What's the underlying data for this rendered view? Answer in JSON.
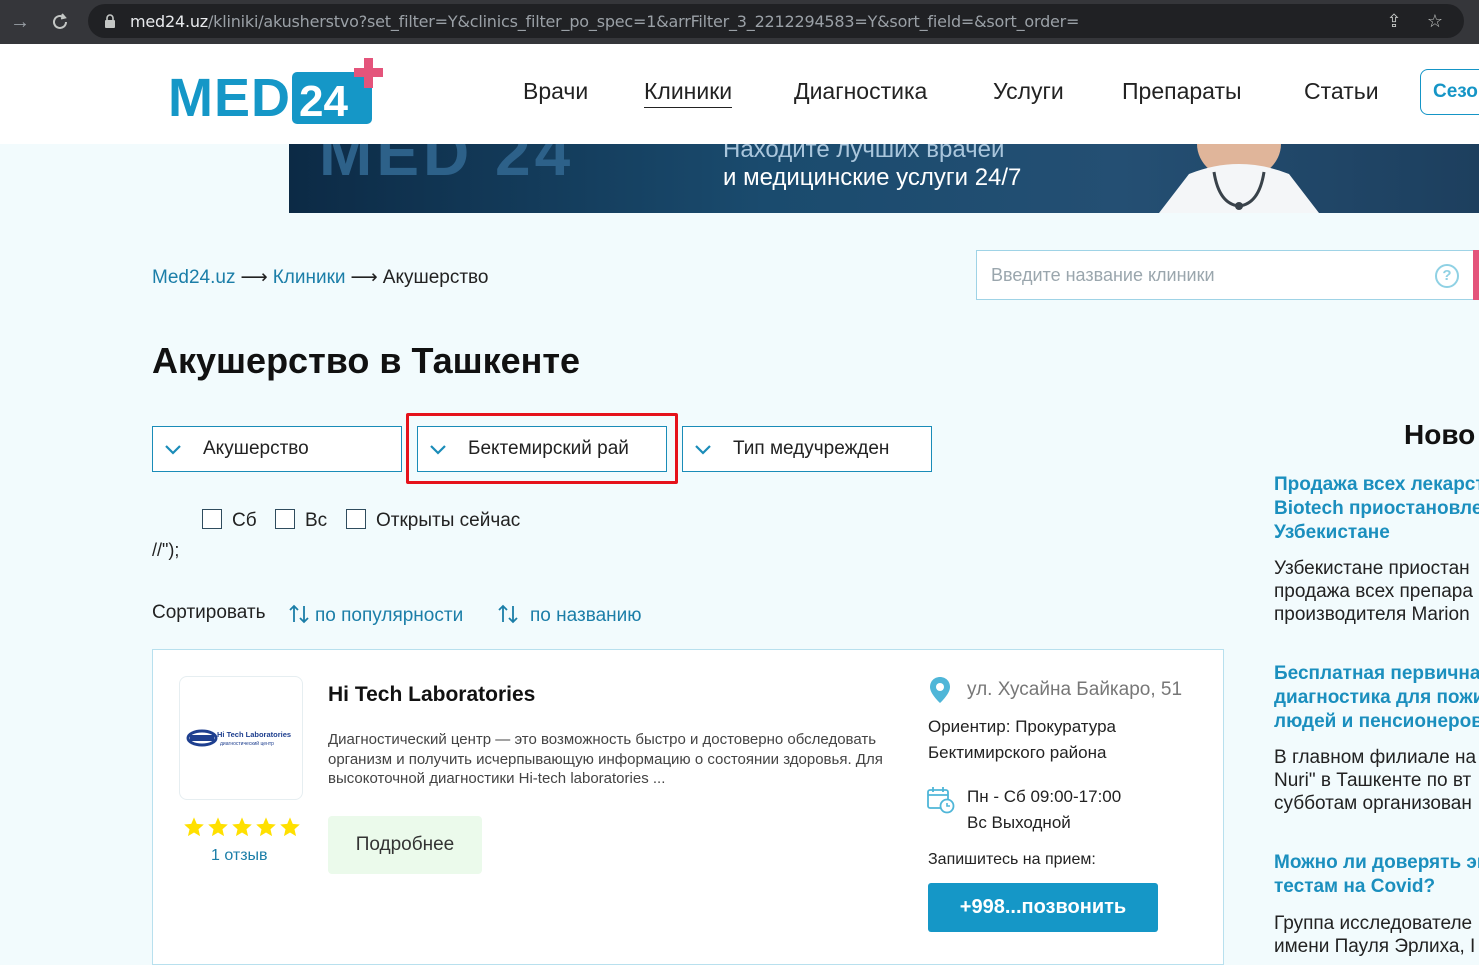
{
  "browser": {
    "url_host": "med24.uz",
    "url_path": "/kliniki/akusherstvo?set_filter=Y&clinics_filter_po_spec=1&arrFilter_3_2212294583=Y&sort_field=&sort_order="
  },
  "header": {
    "logo_text": "MED",
    "logo_num": "24",
    "nav": [
      "Врачи",
      "Клиники",
      "Диагностика",
      "Услуги",
      "Препараты",
      "Статьи"
    ],
    "season_label": "Сезо"
  },
  "banner": {
    "line1": "Находите лучших врачей",
    "line2": "и медицинские услуги 24/7"
  },
  "breadcrumb": {
    "home": "Med24.uz",
    "sep": "⟶",
    "clinics": "Клиники",
    "current": "Акушерство"
  },
  "search": {
    "placeholder": "Введите название клиники",
    "help": "?"
  },
  "page_title": "Акушерство в Ташкенте",
  "filters": {
    "specialty": "Акушерство",
    "district": "Бектемирский рай",
    "type": "Тип медучрежден"
  },
  "checkboxes": {
    "sat": "Сб",
    "sun": "Вс",
    "open_now": "Открыты сейчас"
  },
  "stray_text": "//\");",
  "sort": {
    "label": "Сортировать",
    "by_popularity": "по популярности",
    "by_name": "по названию"
  },
  "clinic": {
    "name": "Hi Tech Laboratories",
    "logo_text": "Hi Tech Laboratories",
    "logo_sub": "диагностический центр",
    "description": "Диагностический центр — это возможность быстро и достоверно обследовать организм и получить исчерпывающую информацию о состоянии здоровья. Для высокоточной диагностики Hi-tech laboratories ...",
    "rating": 5,
    "reviews": "1 отзыв",
    "more": "Подробнее",
    "address": "ул. Хусайна Байкаро, 51",
    "landmark": "Ориентир: Прокуратура Бектимирского района",
    "hours_weekdays": "Пн - Сб 09:00-17:00",
    "hours_sunday": "Вс Выходной",
    "signup": "Запишитесь на прием:",
    "call": "+998...позвонить"
  },
  "news": {
    "heading": "Ново",
    "items": [
      {
        "title": [
          "Продажа всех лекарст",
          "Biotech приостановлен",
          "Узбекистане"
        ],
        "text": [
          "Узбекистане приостан",
          "продажа всех препара",
          "производителя Marion"
        ]
      },
      {
        "title": [
          "Бесплатная первичная",
          "диагностика для пожи",
          "людей и пенсионеров"
        ],
        "text": [
          "В главном филиале на",
          "Nuri\" в Ташкенте по вт",
          "субботам организован"
        ]
      },
      {
        "title": [
          "Можно ли доверять эк",
          "тестам на Covid?"
        ],
        "text": [
          "Группа исследователе",
          "имени Пауля Эрлиха, I"
        ]
      }
    ]
  },
  "colors": {
    "brand_blue": "#1597c7",
    "brand_pink": "#e4547b",
    "highlight_red": "#e5121b",
    "star_yellow": "#ffe000"
  }
}
